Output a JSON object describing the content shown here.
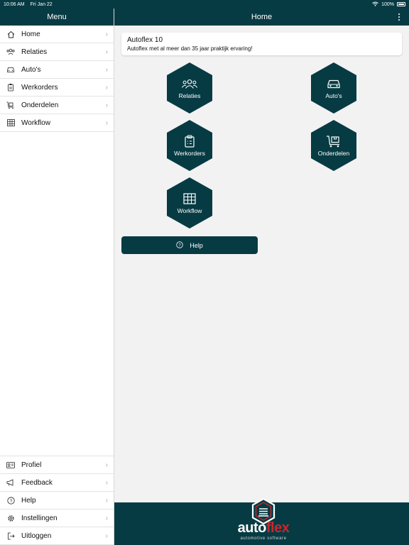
{
  "status_bar": {
    "time": "10:06 AM",
    "date": "Fri Jan 22",
    "battery": "100%"
  },
  "sidebar": {
    "title": "Menu",
    "items": [
      {
        "label": "Home",
        "icon": "home-icon"
      },
      {
        "label": "Relaties",
        "icon": "users-icon"
      },
      {
        "label": "Auto's",
        "icon": "car-icon"
      },
      {
        "label": "Werkorders",
        "icon": "clipboard-icon"
      },
      {
        "label": "Onderdelen",
        "icon": "parts-cart-icon"
      },
      {
        "label": "Workflow",
        "icon": "grid-icon"
      }
    ],
    "bottom_items": [
      {
        "label": "Profiel",
        "icon": "id-card-icon"
      },
      {
        "label": "Feedback",
        "icon": "megaphone-icon"
      },
      {
        "label": "Help",
        "icon": "question-icon"
      },
      {
        "label": "Instellingen",
        "icon": "gear-icon"
      },
      {
        "label": "Uitloggen",
        "icon": "logout-icon"
      }
    ]
  },
  "header": {
    "title": "Home"
  },
  "info_card": {
    "title": "Autoflex 10",
    "subtitle": "Autoflex met al meer dan 35 jaar praktijk ervaring!"
  },
  "tiles": {
    "relaties": "Relaties",
    "autos": "Auto's",
    "werkorders": "Werkorders",
    "onderdelen": "Onderdelen",
    "workflow": "Workflow"
  },
  "help_button": {
    "label": "Help"
  },
  "footer": {
    "logo_main": "auto",
    "logo_accent": "flex",
    "logo_sub": "automotive software"
  },
  "colors": {
    "primary": "#073b43",
    "accent": "#c8282e",
    "background": "#f2f2f2"
  }
}
